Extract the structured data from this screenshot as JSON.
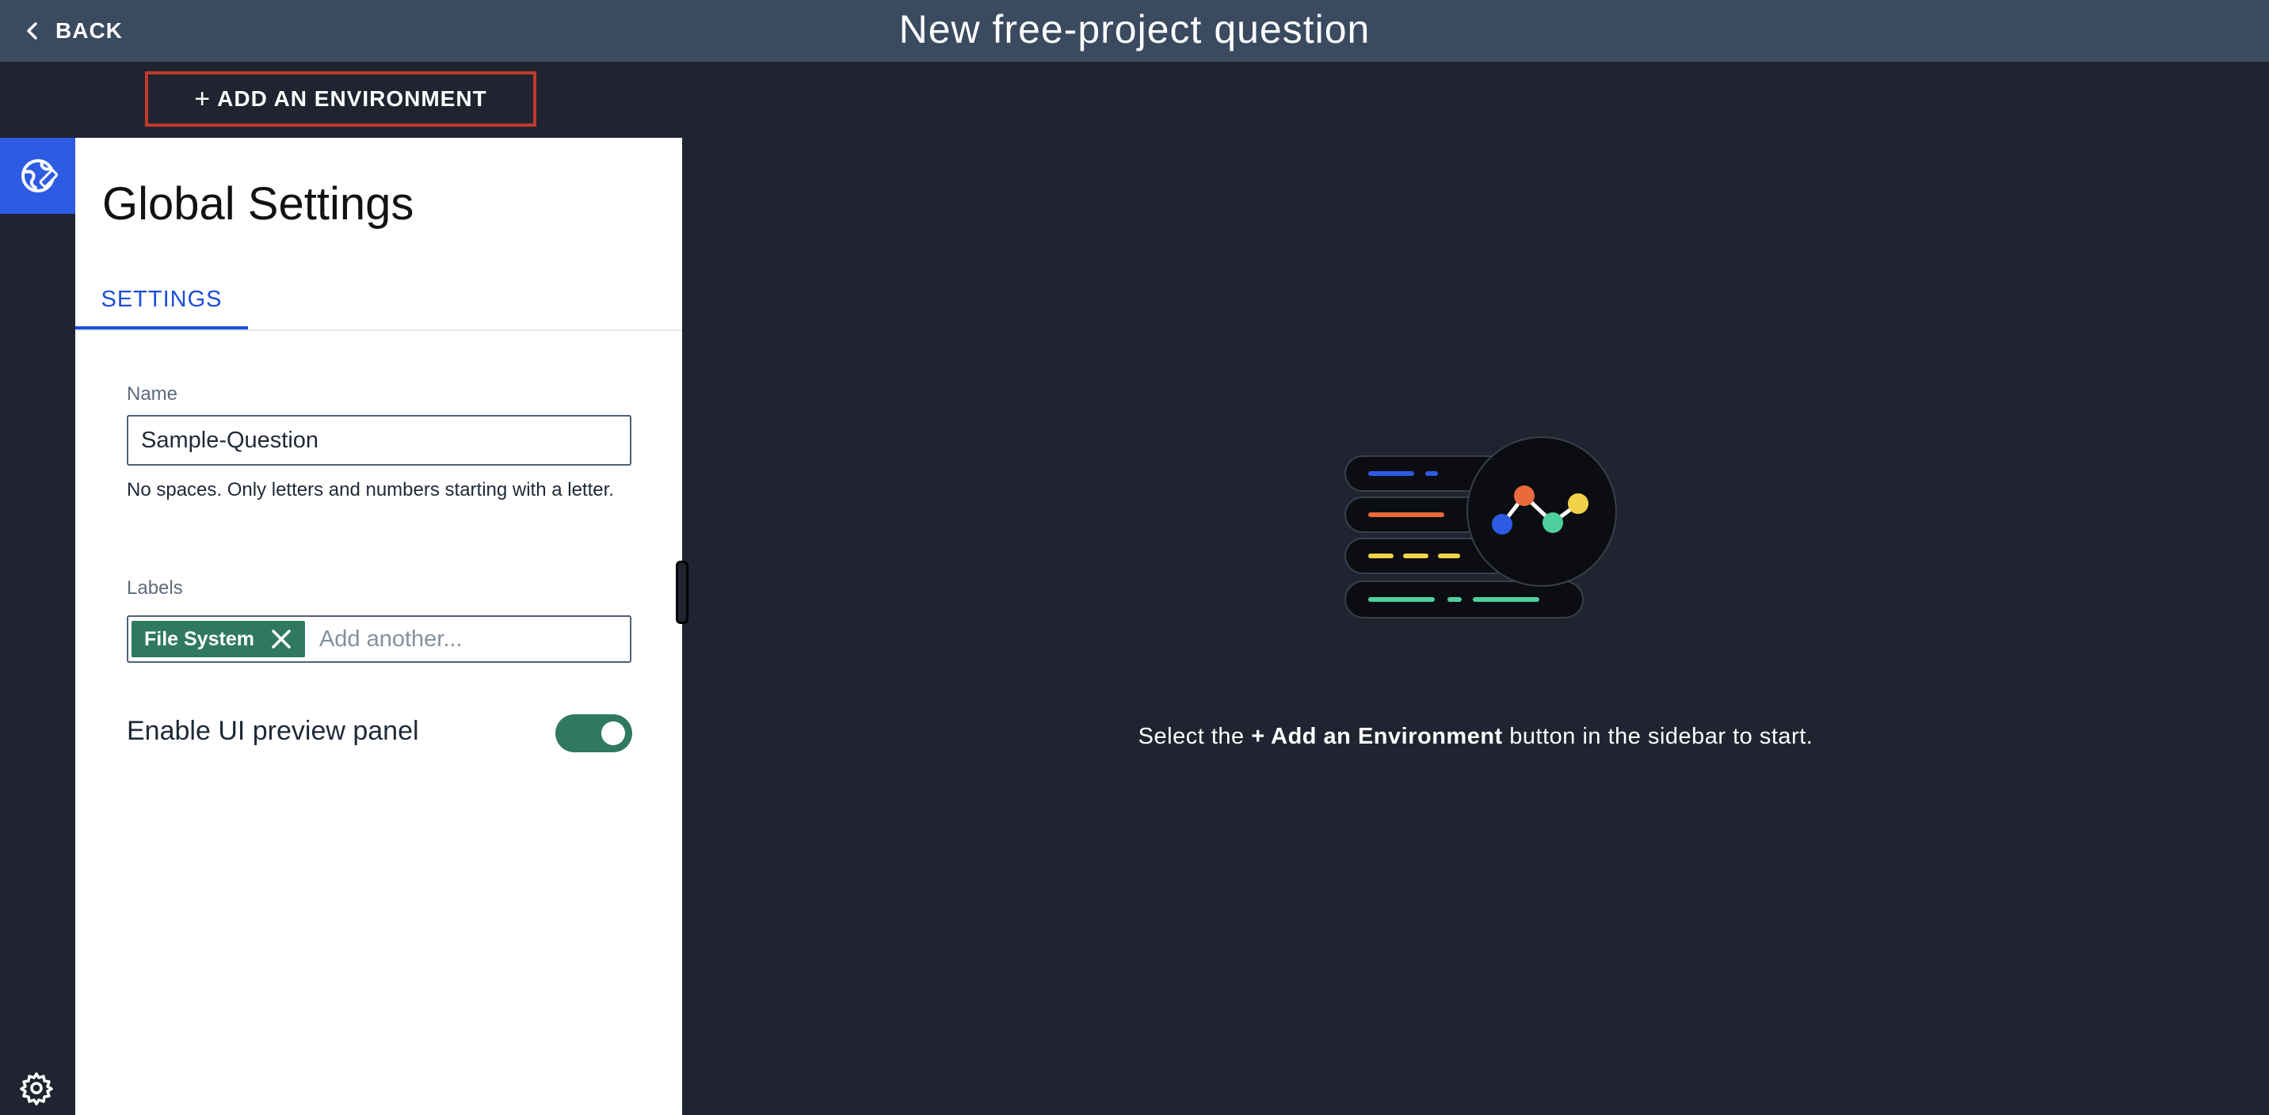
{
  "header": {
    "back_label": "BACK",
    "title": "New free-project question"
  },
  "sidebar": {
    "add_environment_label": "ADD AN ENVIRONMENT",
    "add_environment_plus": "+"
  },
  "panel": {
    "title": "Global Settings",
    "tabs": [
      {
        "label": "SETTINGS",
        "active": true
      }
    ],
    "name_field": {
      "label": "Name",
      "value": "Sample-Question",
      "helper": "No spaces. Only letters and numbers starting with a letter."
    },
    "labels_field": {
      "label": "Labels",
      "chips": [
        {
          "label": "File System"
        }
      ],
      "placeholder": "Add another..."
    },
    "preview_toggle": {
      "label": "Enable UI preview panel",
      "enabled": true
    }
  },
  "main": {
    "empty_prefix": "Select the ",
    "empty_bold": "+ Add an Environment",
    "empty_suffix": " button in the sidebar to start."
  },
  "colors": {
    "background": "#1f2430",
    "topbar": "#3a4a5f",
    "accent_blue": "#2d5be3",
    "tab_blue": "#1d4ed8",
    "success_green": "#2f7a5e",
    "highlight_red": "#c0392b"
  },
  "icons": {
    "back": "chevron-left-icon",
    "rail_top": "globe-edit-icon",
    "rail_bottom": "gear-icon",
    "chip_remove": "close-icon"
  }
}
